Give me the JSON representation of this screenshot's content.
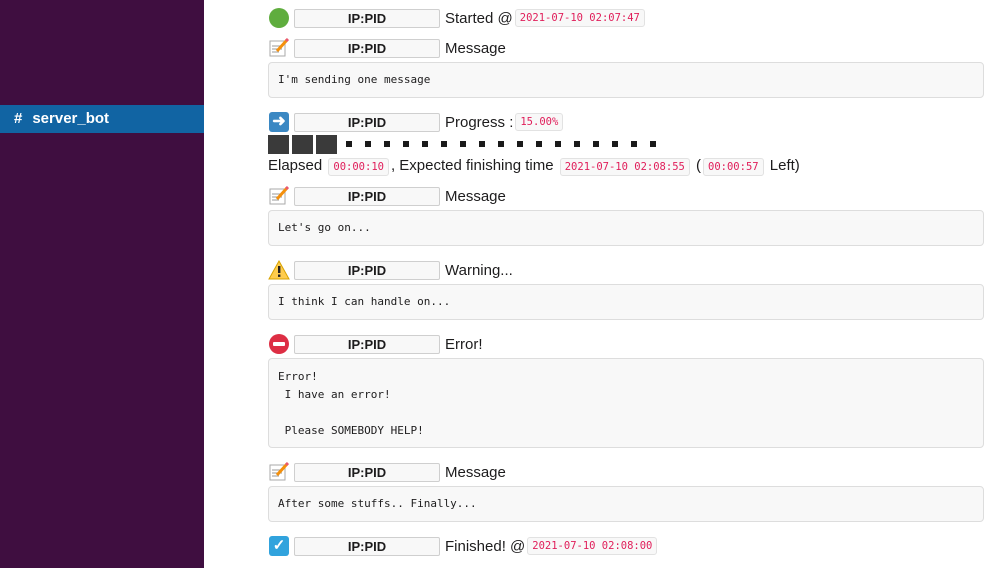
{
  "sidebar": {
    "channel": {
      "hash": "#",
      "name": "server_bot"
    }
  },
  "tag_label": "IP:PID",
  "messages": {
    "started": {
      "icon": "green-circle-icon",
      "text": "Started @",
      "timestamp": "2021-07-10 02:07:47"
    },
    "message1": {
      "icon": "memo-icon",
      "text": "Message",
      "body": [
        "I'm sending one message"
      ]
    },
    "progress": {
      "icon": "arrow-right-icon",
      "text": "Progress :",
      "percent": "15.00%",
      "fraction": 0.15,
      "segments_done": 3,
      "segments_todo": 17
    },
    "eta": {
      "elapsed_label": "Elapsed",
      "elapsed": "00:00:10",
      "expected_label": ", Expected finishing time",
      "expected": "2021-07-10 02:08:55",
      "left_open": "(",
      "left": "00:00:57",
      "left_label": "Left)"
    },
    "message2": {
      "icon": "memo-icon",
      "text": "Message",
      "body": [
        "Let's go on..."
      ]
    },
    "warning": {
      "icon": "warning-icon",
      "text": "Warning...",
      "body": [
        "I think I can handle on..."
      ]
    },
    "error": {
      "icon": "no-entry-icon",
      "text": "Error!",
      "body": [
        "Error!",
        " I have an error!",
        "",
        " Please SOMEBODY HELP!"
      ]
    },
    "message3": {
      "icon": "memo-icon",
      "text": "Message",
      "body": [
        "After some stuffs.. Finally..."
      ]
    },
    "finished": {
      "icon": "check-mark-icon",
      "text": "Finished! @",
      "timestamp": "2021-07-10 02:08:00"
    }
  },
  "colors": {
    "sidebar": "#3f0e40",
    "active_channel": "#1164a3",
    "code_text": "#e01e5a"
  }
}
